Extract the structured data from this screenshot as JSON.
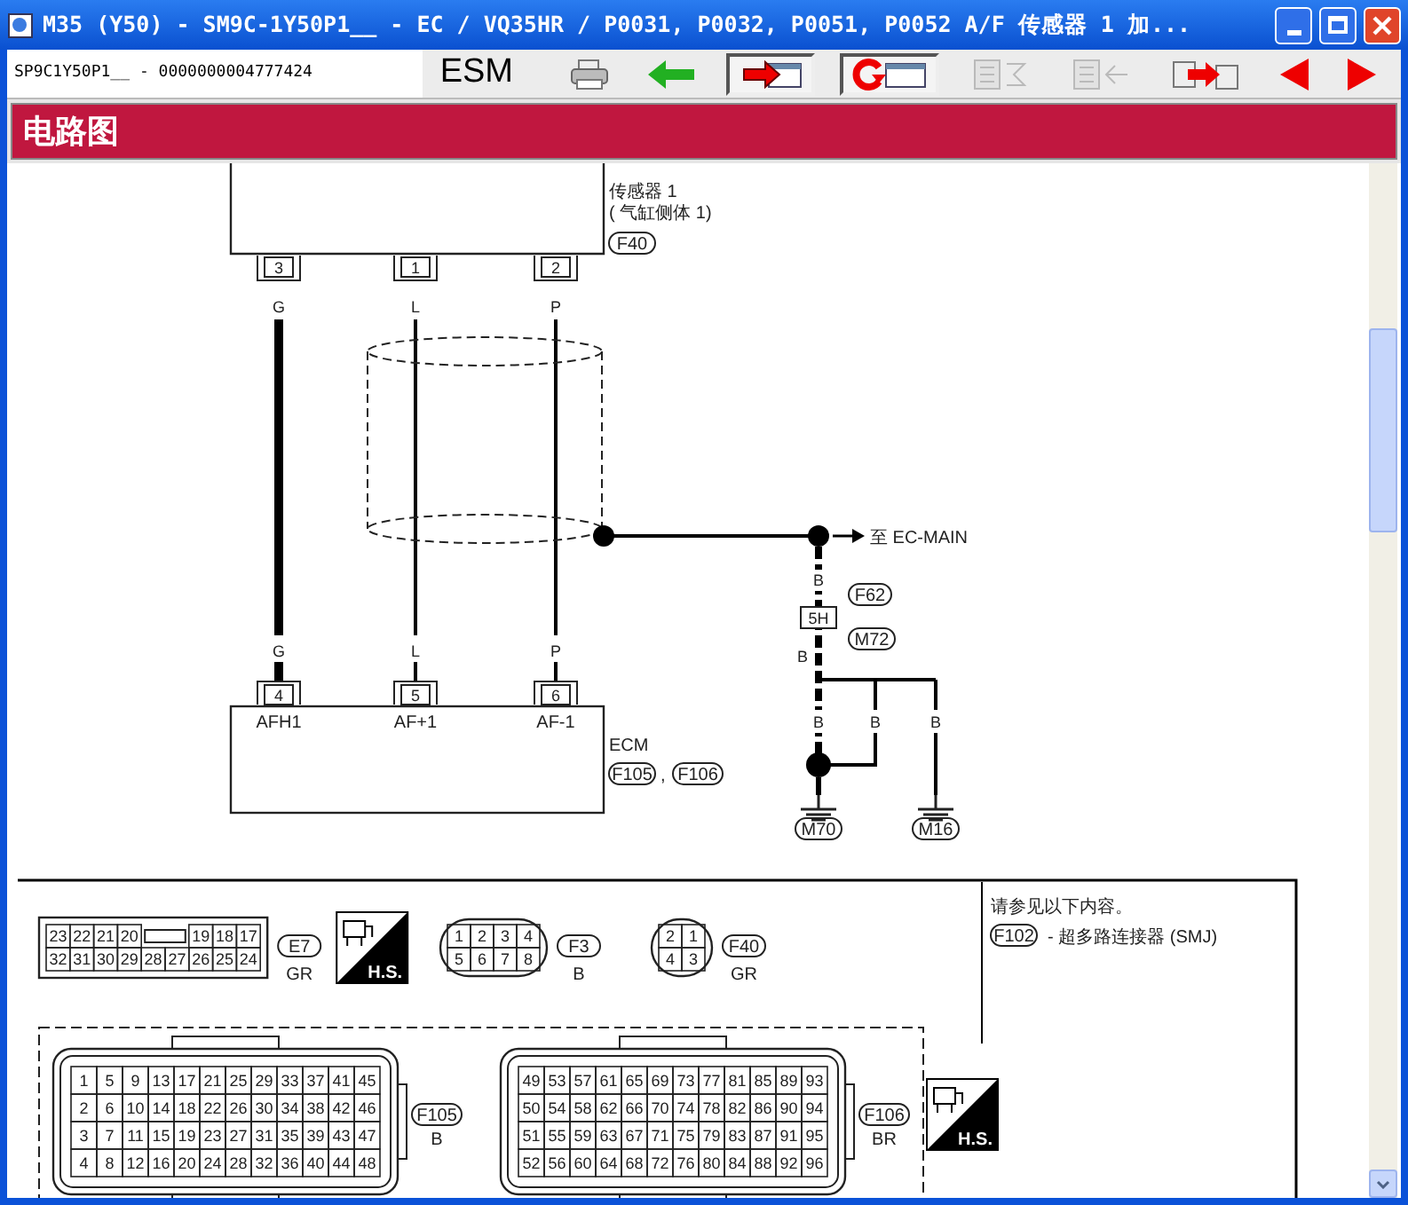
{
  "window": {
    "title": "M35 (Y50) - SM9C-1Y50P1__ - EC / VQ35HR / P0031, P0032, P0051, P0052 A/F 传感器 1 加..."
  },
  "toolbar": {
    "doc_id": "SP9C1Y50P1__ - 0000000004777424",
    "logo": "ESM",
    "buttons": [
      {
        "kind": "print",
        "disabled": false
      },
      {
        "kind": "back",
        "disabled": false
      },
      {
        "kind": "jump",
        "disabled": false
      },
      {
        "kind": "return",
        "disabled": false
      },
      {
        "kind": "collapse",
        "disabled": true
      },
      {
        "kind": "expand",
        "disabled": true
      },
      {
        "kind": "copy",
        "disabled": false
      },
      {
        "kind": "prev",
        "disabled": false
      },
      {
        "kind": "next",
        "disabled": false
      }
    ]
  },
  "header": {
    "title": "电路图"
  },
  "diagram": {
    "sensor": {
      "label_lines": [
        "传感器 1",
        "( 气缸侧体 1)"
      ],
      "connector": "F40",
      "pins": [
        {
          "pin": "3",
          "wire": "G"
        },
        {
          "pin": "1",
          "wire": "L"
        },
        {
          "pin": "2",
          "wire": "P"
        }
      ]
    },
    "ecm": {
      "label": "ECM",
      "connectors": [
        "F105",
        "F106"
      ],
      "separator": ",",
      "pins": [
        {
          "pin": "4",
          "wire": "G",
          "terminal": "AFH1"
        },
        {
          "pin": "5",
          "wire": "L",
          "terminal": "AF+1"
        },
        {
          "pin": "6",
          "wire": "P",
          "terminal": "AF-1"
        }
      ]
    },
    "ground": {
      "destination": "至 EC-MAIN",
      "junction": "5H",
      "connectors": [
        "F62",
        "M72"
      ],
      "wires": [
        "B",
        "B",
        "B",
        "B",
        "B"
      ],
      "grounds": [
        "M70",
        "M16"
      ]
    }
  },
  "connectors": [
    {
      "kind": "block",
      "name": "E7",
      "wire_color": "GR",
      "badge": "H.S.",
      "rows": [
        [
          "23",
          "22",
          "21",
          "20",
          "",
          "",
          "19",
          "18",
          "17"
        ],
        [
          "32",
          "31",
          "30",
          "29",
          "28",
          "27",
          "26",
          "25",
          "24"
        ]
      ]
    },
    {
      "kind": "oval",
      "name": "F3",
      "wire_color": "B",
      "rows": [
        [
          "1",
          "2",
          "3",
          "4"
        ],
        [
          "5",
          "6",
          "7",
          "8"
        ]
      ]
    },
    {
      "kind": "oval",
      "name": "F40",
      "wire_color": "GR",
      "rows": [
        [
          "2",
          "1"
        ],
        [
          "4",
          "3"
        ]
      ]
    }
  ],
  "note": {
    "title": "请参见以下内容。",
    "ref": "F102",
    "text": "- 超多路连接器 (SMJ)"
  },
  "ecm_connectors": [
    {
      "name": "F105",
      "wire_color": "B",
      "rows": [
        [
          "1",
          "5",
          "9",
          "13",
          "17",
          "21",
          "25",
          "29",
          "33",
          "37",
          "41",
          "45"
        ],
        [
          "2",
          "6",
          "10",
          "14",
          "18",
          "22",
          "26",
          "30",
          "34",
          "38",
          "42",
          "46"
        ],
        [
          "3",
          "7",
          "11",
          "15",
          "19",
          "23",
          "27",
          "31",
          "35",
          "39",
          "43",
          "47"
        ],
        [
          "4",
          "8",
          "12",
          "16",
          "20",
          "24",
          "28",
          "32",
          "36",
          "40",
          "44",
          "48"
        ]
      ]
    },
    {
      "name": "F106",
      "wire_color": "BR",
      "badge": "H.S.",
      "rows": [
        [
          "49",
          "53",
          "57",
          "61",
          "65",
          "69",
          "73",
          "77",
          "81",
          "85",
          "89",
          "93"
        ],
        [
          "50",
          "54",
          "58",
          "62",
          "66",
          "70",
          "74",
          "78",
          "82",
          "86",
          "90",
          "94"
        ],
        [
          "51",
          "55",
          "59",
          "63",
          "67",
          "71",
          "75",
          "79",
          "83",
          "87",
          "91",
          "95"
        ],
        [
          "52",
          "56",
          "60",
          "64",
          "68",
          "72",
          "76",
          "80",
          "84",
          "88",
          "92",
          "96"
        ]
      ]
    }
  ]
}
